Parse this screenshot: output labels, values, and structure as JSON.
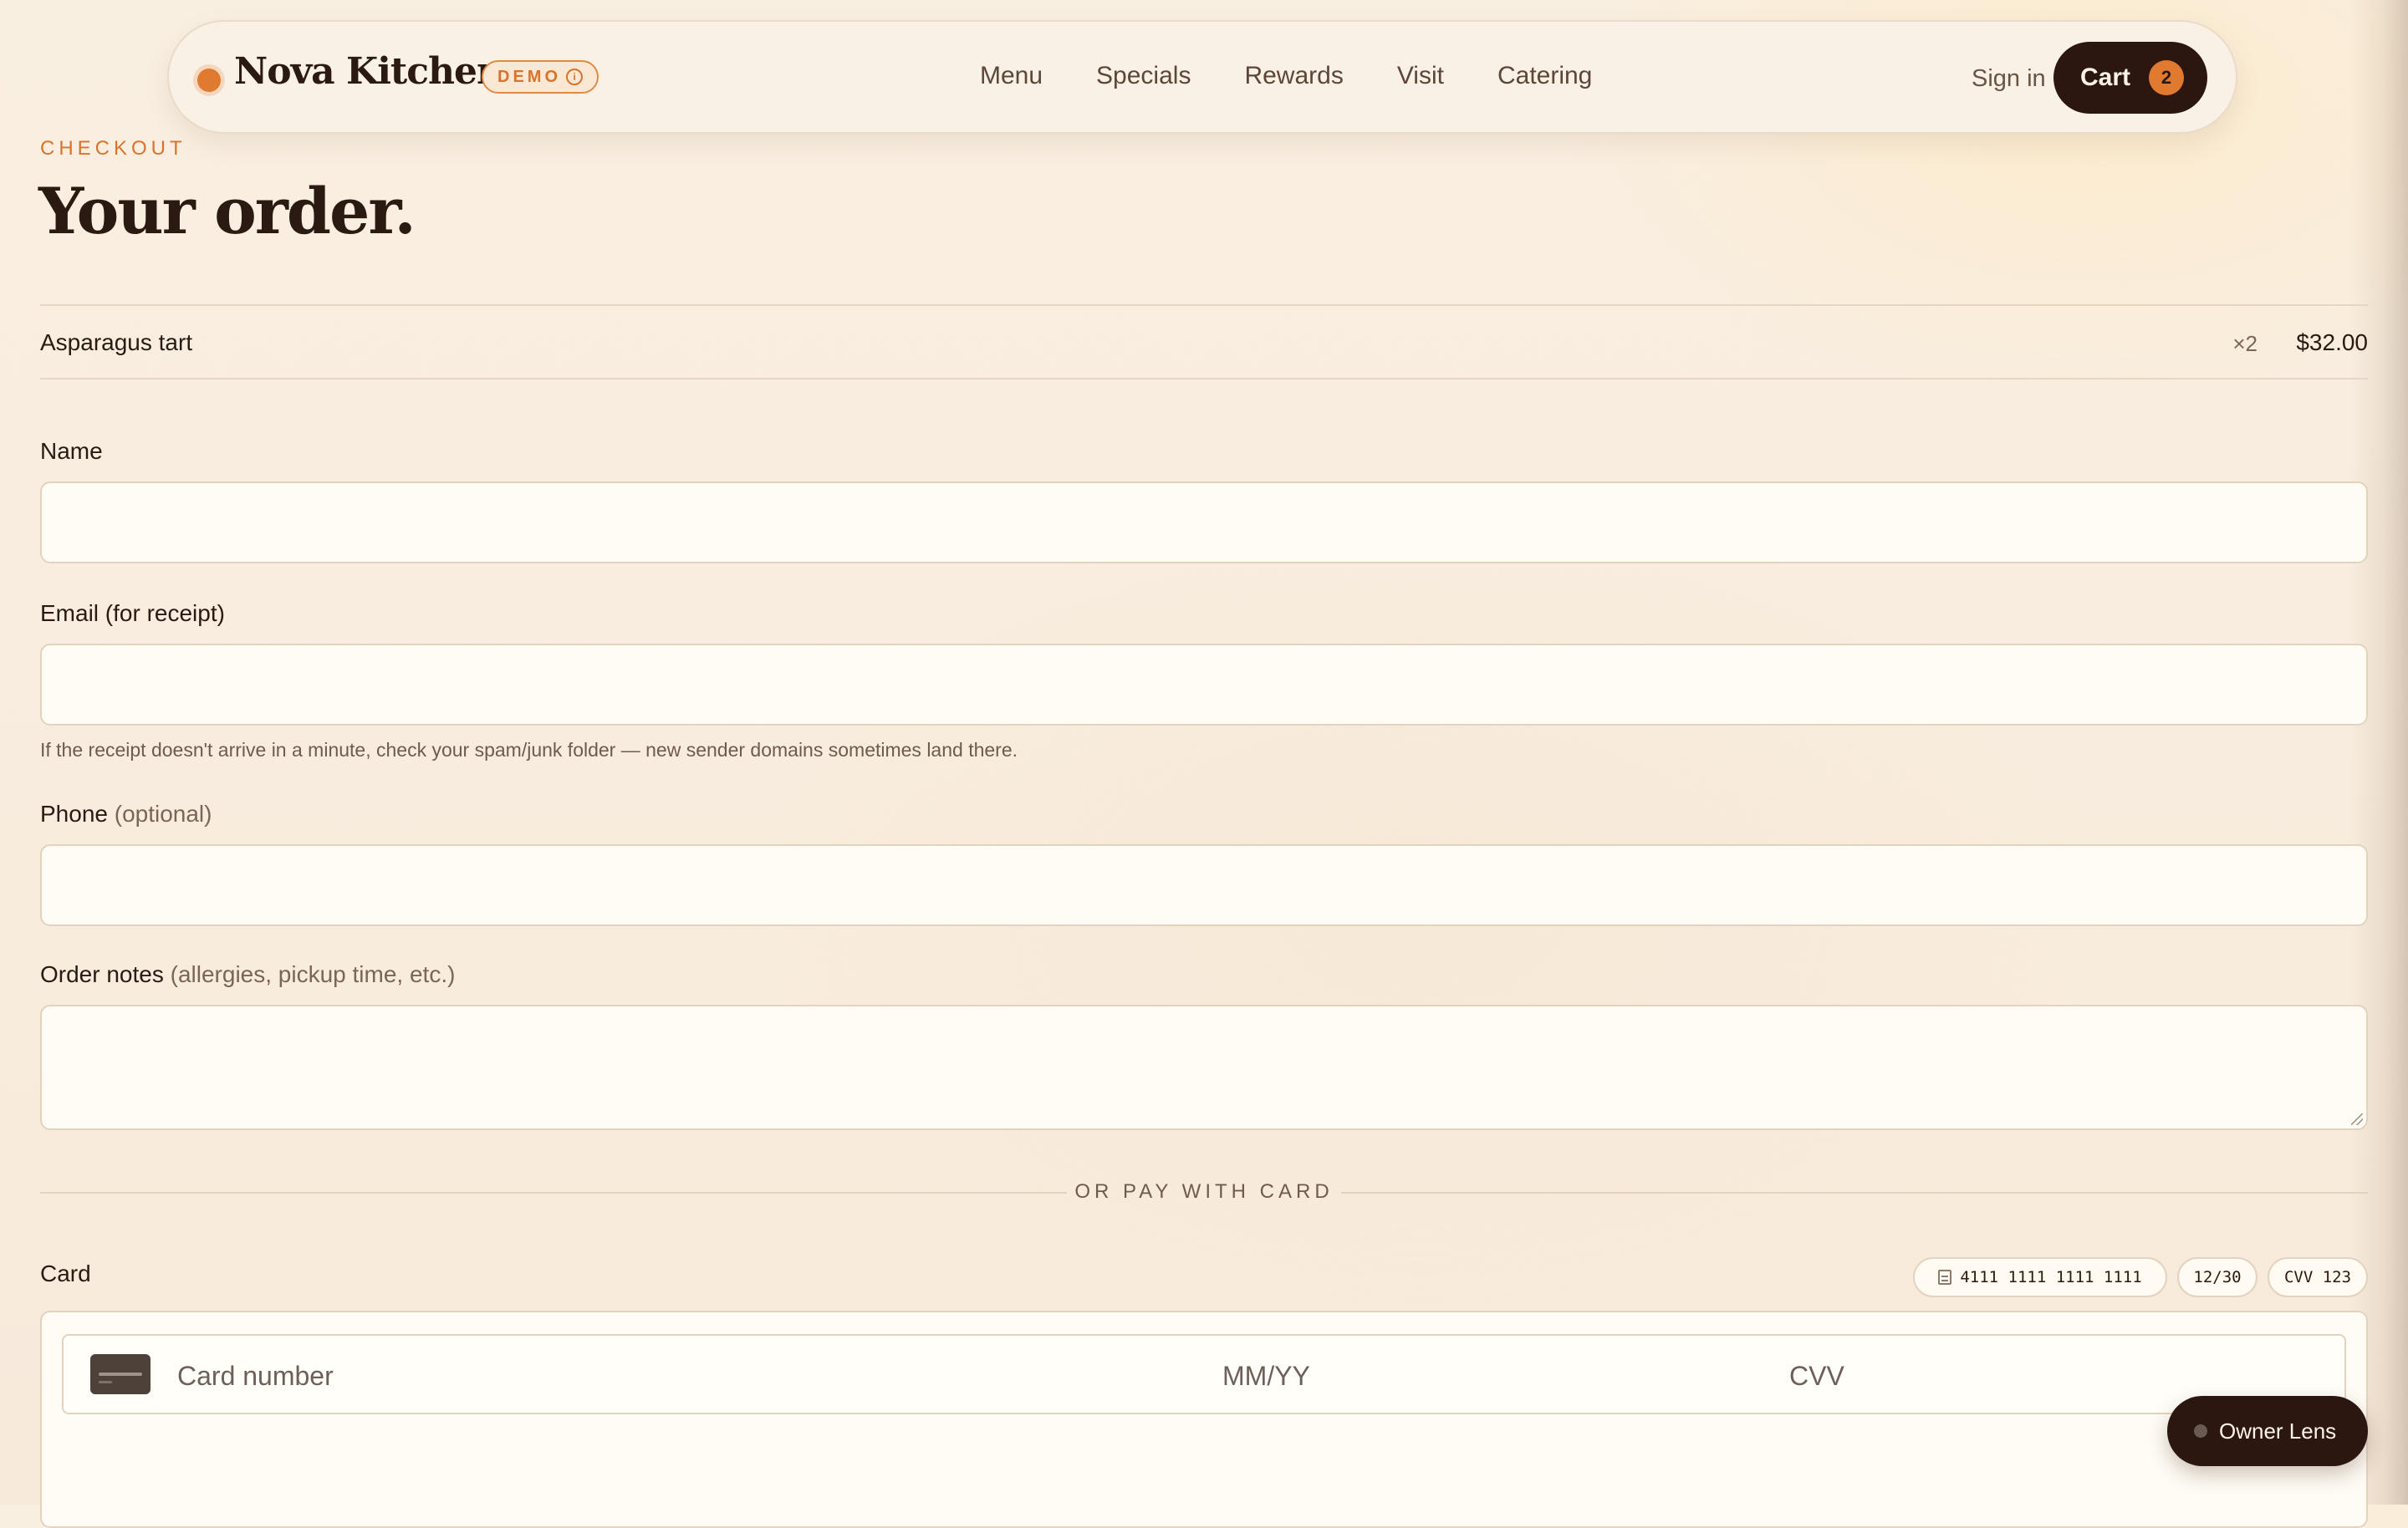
{
  "nav": {
    "brand": "Nova Kitchen",
    "badge": "DEMO",
    "badge_icon": "info-icon",
    "links": [
      "Menu",
      "Specials",
      "Rewards",
      "Visit",
      "Catering"
    ],
    "sign_in": "Sign in",
    "cart_label": "Cart",
    "cart_count": "2"
  },
  "header": {
    "eyebrow": "CHECKOUT",
    "title": "Your order."
  },
  "order": {
    "items": [
      {
        "name": "Asparagus tart",
        "qty": "×2",
        "price": "$32.00"
      }
    ]
  },
  "form": {
    "name_label": "Name",
    "name_value": "",
    "email_label": "Email (for receipt)",
    "email_value": "",
    "email_hint": "If the receipt doesn't arrive in a minute, check your spam/junk folder — new sender domains sometimes land there.",
    "phone_label": "Phone",
    "phone_optional": "(optional)",
    "phone_value": "",
    "notes_label": "Order notes",
    "notes_hint": "(allergies, pickup time, etc.)",
    "notes_value": ""
  },
  "card": {
    "divider": "OR PAY WITH CARD",
    "label": "Card",
    "test_number": "4111 1111 1111 1111",
    "test_expiry": "12/30",
    "test_cvv": "CVV 123",
    "number_placeholder": "Card number",
    "expiry_placeholder": "MM/YY",
    "cvv_placeholder": "CVV"
  },
  "owner_lens": {
    "label": "Owner Lens"
  },
  "colors": {
    "accent": "#e07a30",
    "dark": "#2b1610",
    "background": "#f9efe1",
    "field": "#fffcf5"
  }
}
